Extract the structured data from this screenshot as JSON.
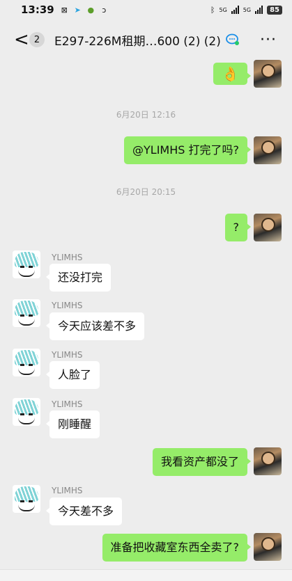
{
  "status_bar": {
    "time": "13:39",
    "network_1": "5G",
    "network_2": "5G",
    "battery": "85"
  },
  "header": {
    "back_glyph": "<",
    "unread_count": "2",
    "title": "E297-226M租期…600 (2) (2)",
    "more_glyph": "···"
  },
  "messages": {
    "m0": {
      "text": "👌"
    },
    "t1": "6月20日 12:16",
    "m1": {
      "text": "@YLIMHS  打完了吗?"
    },
    "t2": "6月20日 20:15",
    "m2": {
      "text": "?"
    },
    "m3": {
      "sender": "YLIMHS",
      "text": "还没打完"
    },
    "m4": {
      "sender": "YLIMHS",
      "text": "今天应该差不多"
    },
    "m5": {
      "sender": "YLIMHS",
      "text": "人脸了"
    },
    "m6": {
      "sender": "YLIMHS",
      "text": "刚睡醒"
    },
    "m7": {
      "text": "我看资产都没了"
    },
    "m8": {
      "sender": "YLIMHS",
      "text": "今天差不多"
    },
    "m9": {
      "text": "准备把收藏室东西全卖了?"
    }
  },
  "colors": {
    "my_bubble": "#95ec69",
    "other_bubble": "#ffffff",
    "background": "#ededed"
  }
}
